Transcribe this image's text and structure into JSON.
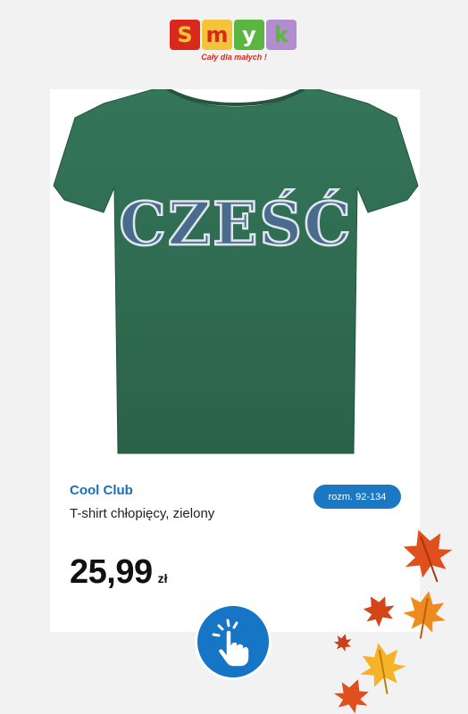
{
  "logo": {
    "letters": [
      "S",
      "m",
      "y",
      "k"
    ],
    "tagline": "Cały dla małych !",
    "colors": [
      "#f3c43a",
      "#d9281c",
      "#5bb63f",
      "#b38ccf"
    ]
  },
  "product": {
    "brand": "Cool Club",
    "name": "T-shirt chłopięcy, zielony",
    "price": "25,99",
    "currency": "zł",
    "size_badge": "rozm. 92-134",
    "print_text": "CZEŚĆ",
    "shirt_color": "#2e6b4f",
    "brand_color": "#1a6fb4"
  },
  "cta": {
    "icon": "tap-hand-icon",
    "color": "#1775c6"
  },
  "decor": {
    "icon": "autumn-leaves-icon",
    "colors": [
      "#e0501d",
      "#f08a1f",
      "#f7b328"
    ]
  }
}
